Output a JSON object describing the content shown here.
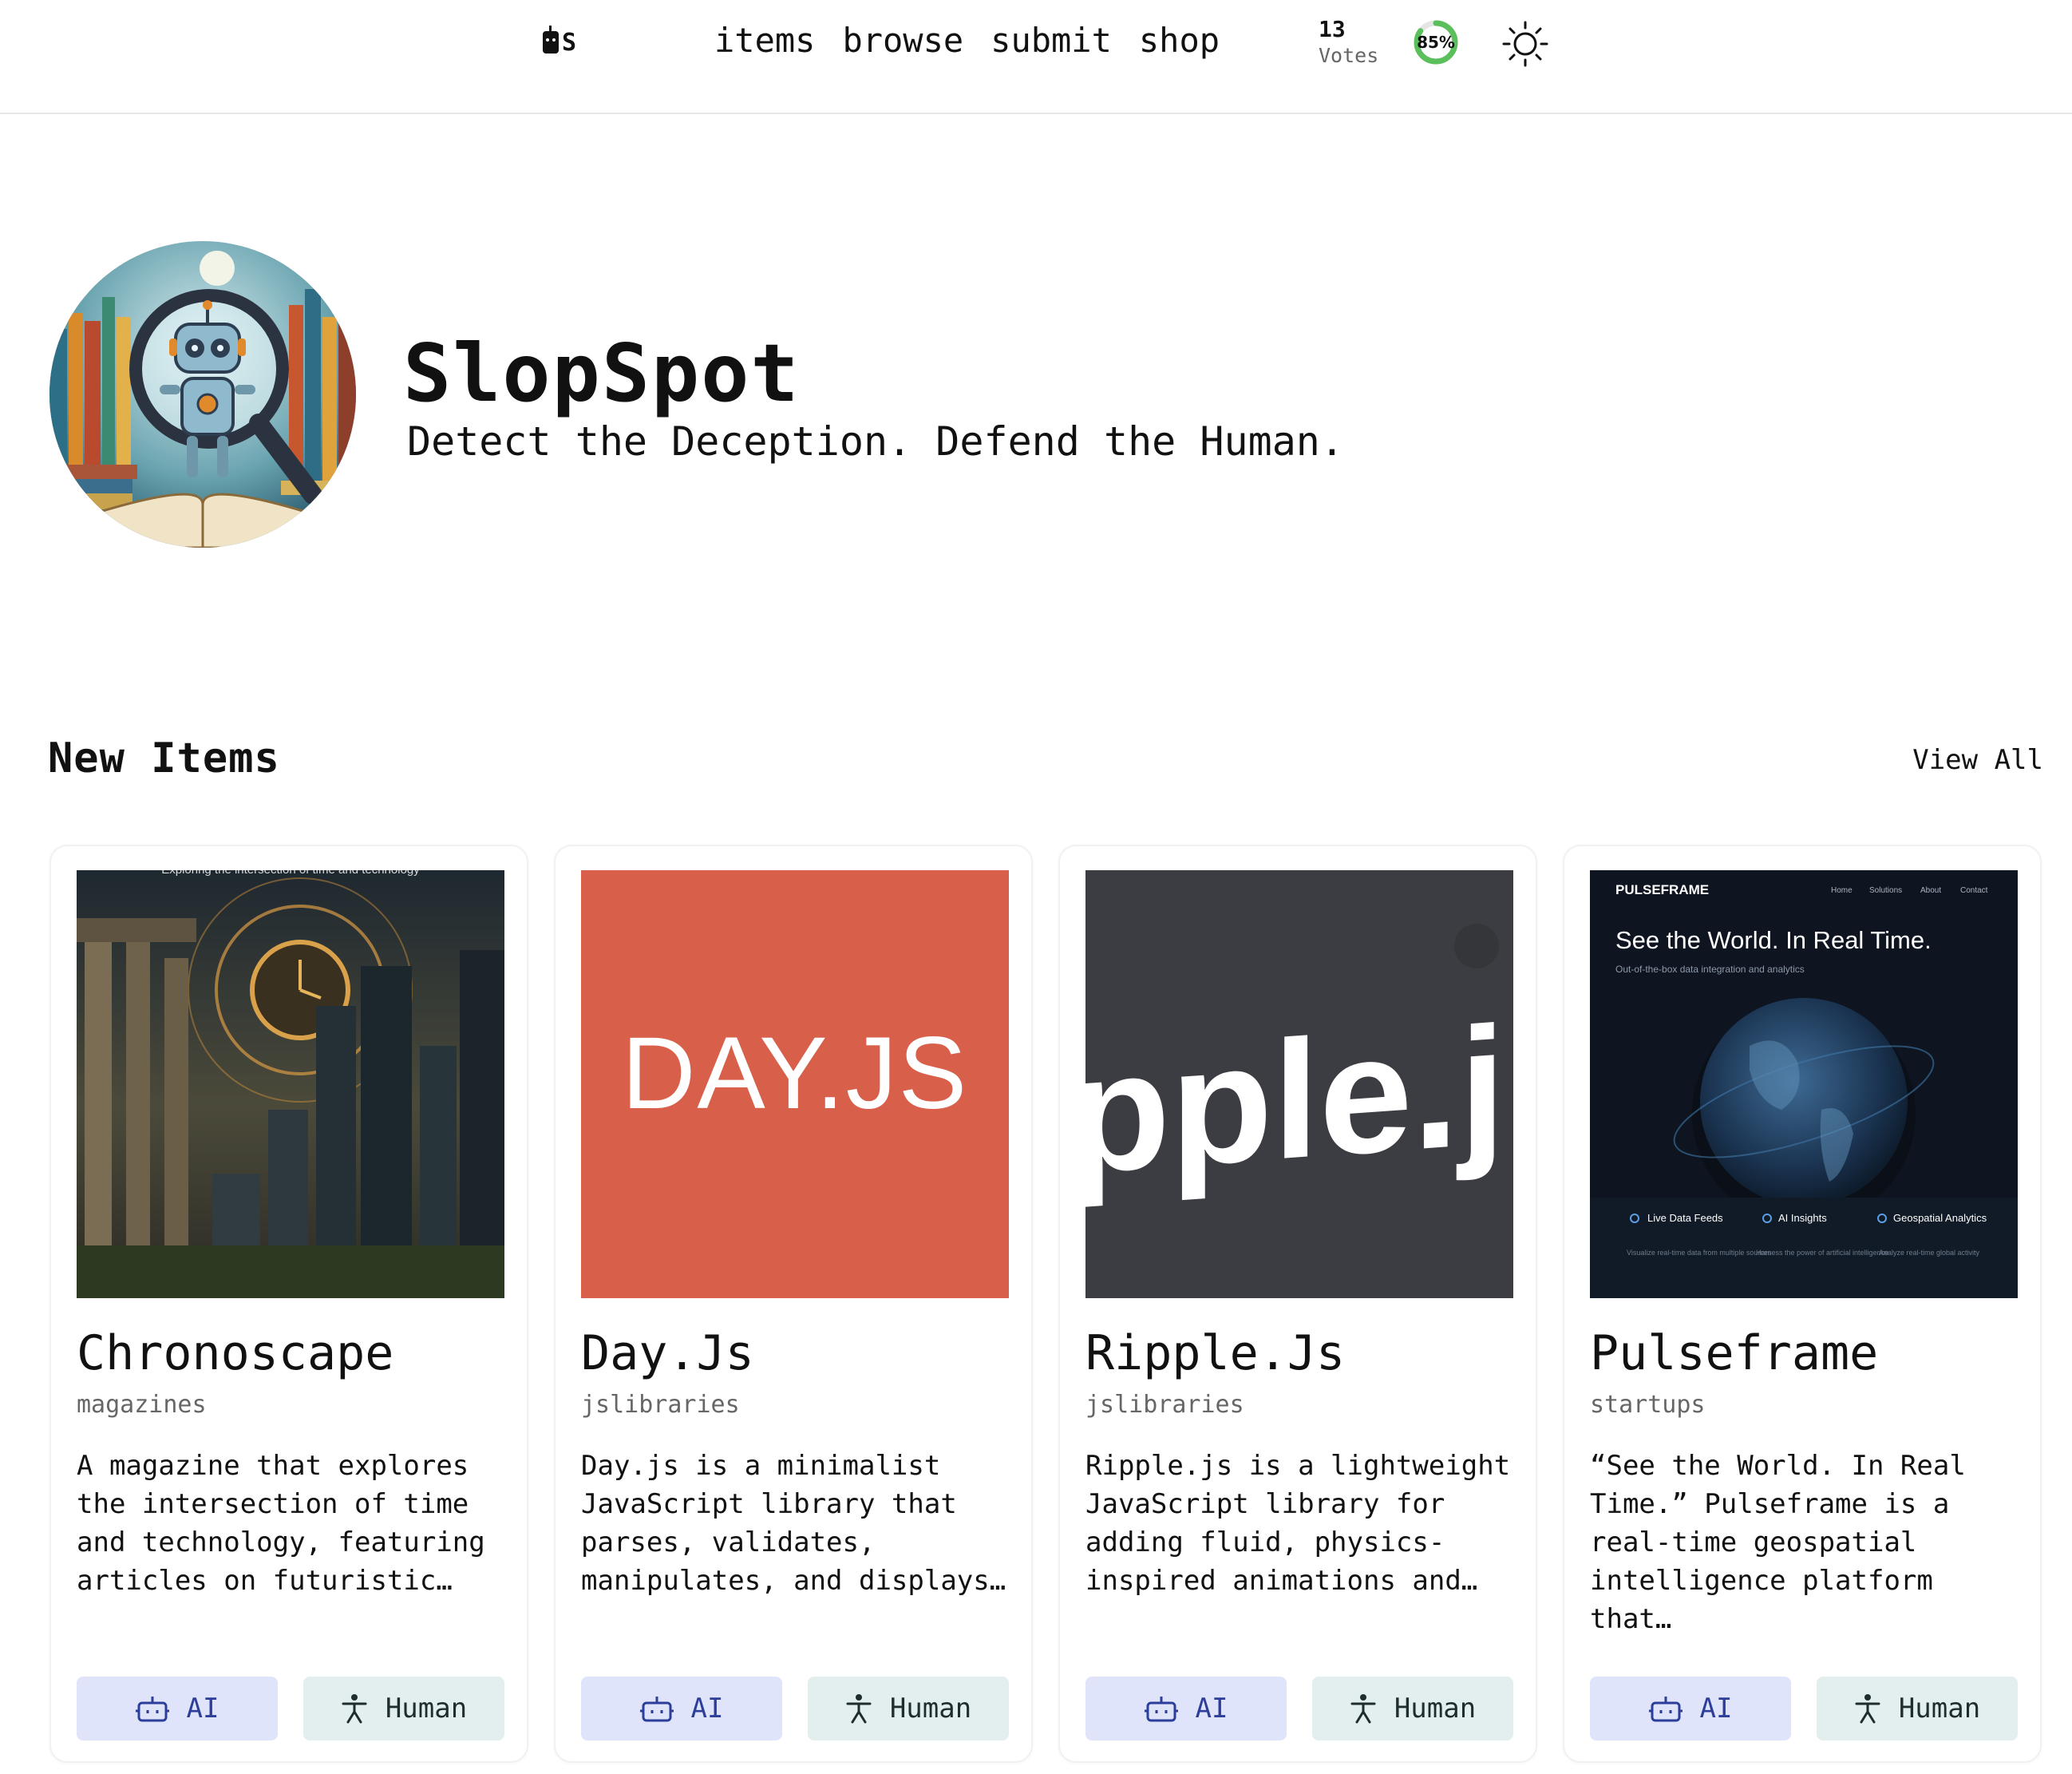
{
  "header": {
    "logo_text": "S",
    "nav": [
      "items",
      "browse",
      "submit",
      "shop"
    ],
    "votes_count": "13",
    "votes_label": "Votes",
    "accuracy_percent": 85,
    "accuracy_label": "85%"
  },
  "hero": {
    "title": "SlopSpot",
    "subtitle": "Detect the Deception. Defend the Human."
  },
  "section": {
    "title": "New Items",
    "view_all": "View All"
  },
  "colors": {
    "ai_button_bg": "#e0e4fb",
    "human_button_bg": "#e3efee",
    "dayjs_bg": "#d8604a",
    "ripple_bg": "#3b3d42",
    "pulseframe_bg": "#0e1521",
    "ring_green": "#5bbf5b"
  },
  "items": [
    {
      "title": "Chronoscape",
      "category": "magazines",
      "description": "A magazine that explores the intersection of time and technology, featuring articles on futuristic…",
      "thumb_caption": "Exploring the intersection of time and technology",
      "ai_label": "AI",
      "human_label": "Human"
    },
    {
      "title": "Day.Js",
      "category": "jslibraries",
      "description": "Day.js is a minimalist JavaScript library that parses, validates, manipulates, and displays…",
      "thumb_text": "DAY.JS",
      "ai_label": "AI",
      "human_label": "Human"
    },
    {
      "title": "Ripple.Js",
      "category": "jslibraries",
      "description": "Ripple.js is a lightweight JavaScript library for adding fluid, physics-inspired animations and…",
      "thumb_text": "pple.j",
      "ai_label": "AI",
      "human_label": "Human"
    },
    {
      "title": "Pulseframe",
      "category": "startups",
      "description": "“See the World. In Real Time.” Pulseframe is a real-time geospatial intelligence platform that…",
      "thumb": {
        "brand": "PULSEFRAME",
        "nav": [
          "Home",
          "Solutions",
          "About",
          "Contact"
        ],
        "headline": "See the World. In Real Time.",
        "subline": "Out-of-the-box data integration and analytics",
        "features": [
          {
            "title": "Live Data Feeds",
            "text": "Visualize real-time data from multiple sources"
          },
          {
            "title": "AI Insights",
            "text": "Harness the power of artificial intelligence"
          },
          {
            "title": "Geospatial Analytics",
            "text": "Analyze real-time global activity"
          }
        ]
      },
      "ai_label": "AI",
      "human_label": "Human"
    }
  ]
}
